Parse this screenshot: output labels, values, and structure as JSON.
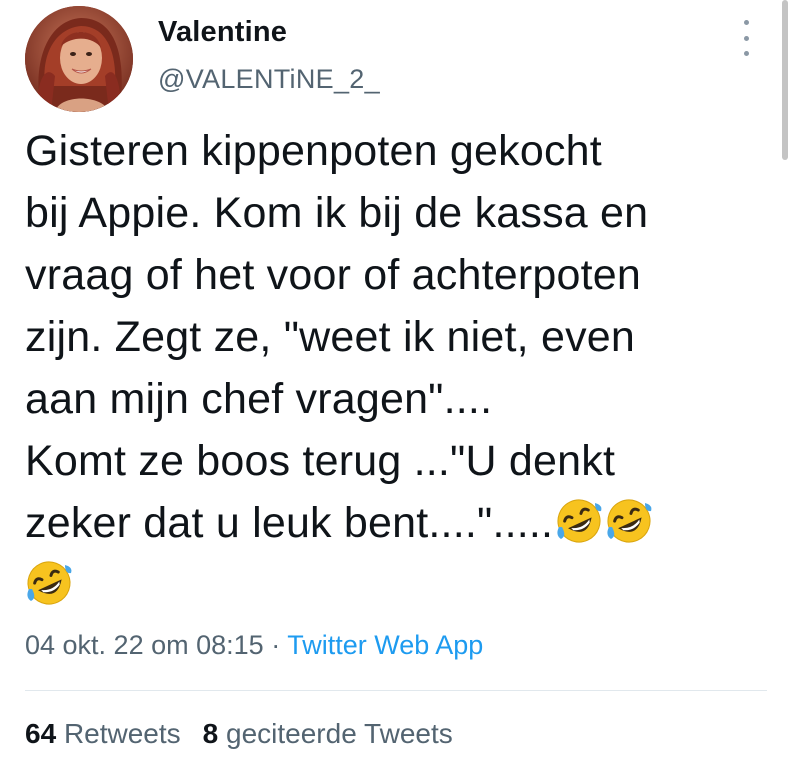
{
  "author": {
    "name": "Valentine",
    "handle": "@VALENTiNE_2_"
  },
  "tweet": {
    "lines": [
      "Gisteren kippenpoten gekocht",
      "bij Appie. Kom ik bij de kassa en",
      "vraag of het voor of achterpoten",
      "zijn. Zegt ze, \"weet ik niet, even",
      "aan mijn chef vragen\"....",
      "Komt ze boos terug ...\"U denkt",
      "zeker dat u leuk bent....\"....."
    ],
    "emoji_name": "rolling-on-the-floor-laughing-icon"
  },
  "meta": {
    "timestamp": "04 okt. 22 om 08:15",
    "separator": "·",
    "source": "Twitter Web App"
  },
  "stats": {
    "retweets_count": "64",
    "retweets_label": "Retweets",
    "quotes_count": "8",
    "quotes_label": "geciteerde Tweets"
  },
  "colors": {
    "text": "#0f1419",
    "secondary": "#536471",
    "link": "#1d9bf0",
    "divider": "#e1e8ed"
  }
}
